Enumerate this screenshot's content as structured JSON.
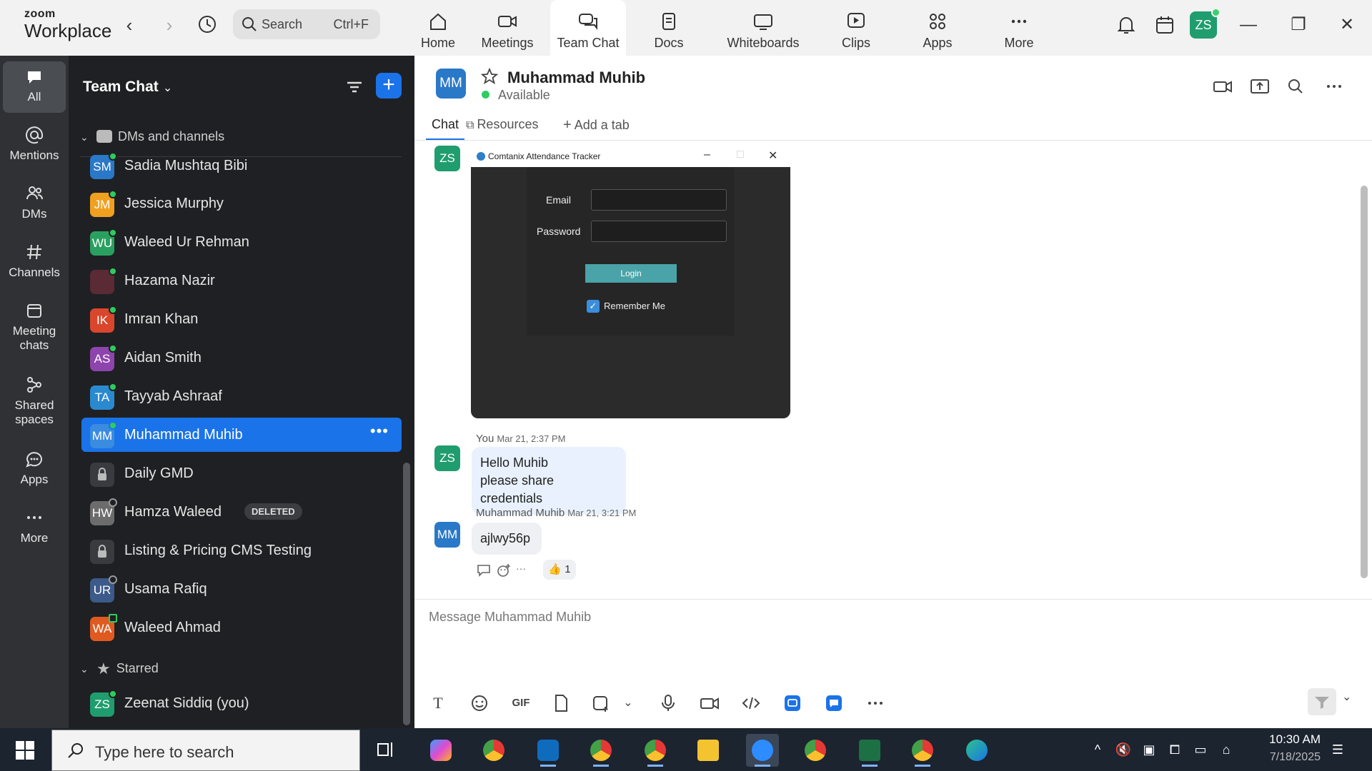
{
  "topbar": {
    "brand_line1": "zoom",
    "brand_line2": "Workplace",
    "search_label": "Search",
    "search_shortcut": "Ctrl+F",
    "nav": [
      {
        "label": "Home",
        "icon": "home-icon"
      },
      {
        "label": "Meetings",
        "icon": "video-icon"
      },
      {
        "label": "Team Chat",
        "icon": "chat-icon"
      },
      {
        "label": "Docs",
        "icon": "doc-icon"
      },
      {
        "label": "Whiteboards",
        "icon": "whiteboard-icon"
      },
      {
        "label": "Clips",
        "icon": "clips-icon"
      },
      {
        "label": "Apps",
        "icon": "apps-icon"
      },
      {
        "label": "More",
        "icon": "more-icon"
      }
    ],
    "active_nav": "Team Chat",
    "user_initials": "ZS"
  },
  "rail": {
    "items": [
      {
        "label": "All",
        "icon": "chat-bubble-icon"
      },
      {
        "label": "Mentions",
        "icon": "at-icon"
      },
      {
        "label": "DMs",
        "icon": "people-icon"
      },
      {
        "label": "Channels",
        "icon": "hash-icon"
      },
      {
        "label": "Meeting chats",
        "icon": "calendar-icon"
      },
      {
        "label": "Shared spaces",
        "icon": "share-icon"
      },
      {
        "label": "Apps",
        "icon": "apps-chat-icon"
      },
      {
        "label": "More",
        "icon": "more-icon"
      }
    ]
  },
  "panel": {
    "title": "Team Chat",
    "section_dms": "DMs and channels",
    "section_starred": "Starred",
    "deleted_badge": "DELETED",
    "items": [
      {
        "initials": "SM",
        "name": "Sadia Mushtaq Bibi",
        "color": "#2a78c8",
        "status": "online"
      },
      {
        "initials": "JM",
        "name": "Jessica Murphy",
        "color": "#f0a020",
        "status": "online"
      },
      {
        "initials": "WU",
        "name": "Waleed Ur Rehman",
        "color": "#2aa060",
        "status": "online"
      },
      {
        "initials": "",
        "name": "Hazama Nazir",
        "color": "#5a2a35",
        "status": "online"
      },
      {
        "initials": "IK",
        "name": "Imran Khan",
        "color": "#d9462c",
        "status": "online"
      },
      {
        "initials": "AS",
        "name": "Aidan Smith",
        "color": "#8e44ad",
        "status": "online"
      },
      {
        "initials": "TA",
        "name": "Tayyab Ashraaf",
        "color": "#2a8ad0",
        "status": "online"
      },
      {
        "initials": "MM",
        "name": "Muhammad Muhib",
        "color": "#3a8ce0",
        "status": "online"
      },
      {
        "initials": "",
        "name": "Daily GMD",
        "color": "#3a3b3f",
        "status": "lock"
      },
      {
        "initials": "HW",
        "name": "Hamza Waleed",
        "color": "#6c6c6c",
        "status": "away"
      },
      {
        "initials": "",
        "name": "Listing & Pricing CMS Testing",
        "color": "#3a3b3f",
        "status": "lock"
      },
      {
        "initials": "UR",
        "name": "Usama Rafiq",
        "color": "#3c5a8a",
        "status": "away"
      },
      {
        "initials": "WA",
        "name": "Waleed Ahmad",
        "color": "#e05a20",
        "status": "mobile"
      },
      {
        "initials": "ZS",
        "name": "Zeenat Siddiq (you)",
        "color": "#1f9d6e",
        "status": "online"
      }
    ]
  },
  "chat": {
    "contact_initials": "MM",
    "contact_name": "Muhammad Muhib",
    "contact_status": "Available",
    "tabs": [
      "Chat",
      "Resources",
      "Add a tab"
    ],
    "screenshot": {
      "window_title": "Comtanix Attendance Tracker",
      "email_label": "Email",
      "password_label": "Password",
      "login_label": "Login",
      "remember_label": "Remember Me"
    },
    "messages": [
      {
        "sender": "You",
        "time": "Mar 21, 2:37 PM",
        "initials": "ZS",
        "lines": [
          "Hello Muhib",
          "please share credentials"
        ]
      },
      {
        "sender": "Muhammad Muhib",
        "time": "Mar 21, 3:21 PM",
        "initials": "MM",
        "lines": [
          "ajlwy56p"
        ]
      }
    ],
    "reaction": {
      "emoji": "👍",
      "count": "1"
    },
    "composer_placeholder": "Message Muhammad Muhib",
    "toolbar": {
      "gif": "GIF",
      "text": "T"
    }
  },
  "taskbar": {
    "search_placeholder": "Type here to search",
    "time": "10:30 AM",
    "date": "7/18/2025"
  }
}
